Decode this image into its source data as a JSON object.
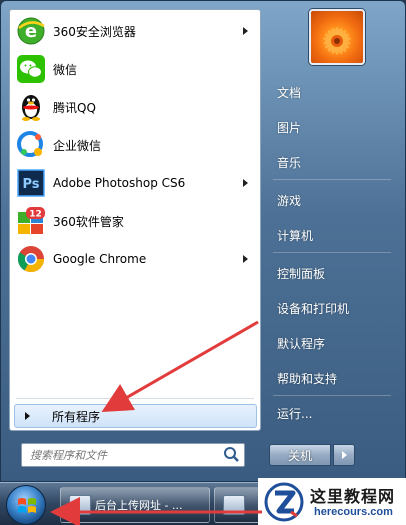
{
  "start_menu": {
    "programs": [
      {
        "label": "360安全浏览器",
        "icon": "ie-style-browser-icon",
        "has_submenu": true
      },
      {
        "label": "微信",
        "icon": "wechat-icon",
        "has_submenu": false
      },
      {
        "label": "腾讯QQ",
        "icon": "qq-penguin-icon",
        "has_submenu": false
      },
      {
        "label": "企业微信",
        "icon": "wecom-icon",
        "has_submenu": false
      },
      {
        "label": "Adobe Photoshop CS6",
        "icon": "photoshop-icon",
        "has_submenu": true
      },
      {
        "label": "360软件管家",
        "icon": "360-software-manager-icon",
        "has_submenu": false
      },
      {
        "label": "Google Chrome",
        "icon": "chrome-icon",
        "has_submenu": true
      }
    ],
    "badge_360_manager": "12",
    "photoshop_icon_text": "Ps",
    "all_programs_label": "所有程序",
    "search_placeholder": "搜索程序和文件",
    "right_items": [
      {
        "label": "文档"
      },
      {
        "label": "图片"
      },
      {
        "label": "音乐"
      },
      {
        "label": "游戏"
      },
      {
        "label": "计算机"
      },
      {
        "label": "控制面板"
      },
      {
        "label": "设备和打印机"
      },
      {
        "label": "默认程序"
      },
      {
        "label": "帮助和支持"
      },
      {
        "label": "运行..."
      }
    ],
    "shutdown_label": "关机"
  },
  "taskbar": {
    "buttons": [
      {
        "label": "后台上传网址 - ..."
      },
      {
        "label": ""
      }
    ]
  },
  "watermark": {
    "title": "这里教程网",
    "url": "herecours.com"
  },
  "colors": {
    "annotation_arrow": "#e23b3b",
    "menu_frame": "#4d7196",
    "all_programs_highlight": "#cfe3f9"
  }
}
